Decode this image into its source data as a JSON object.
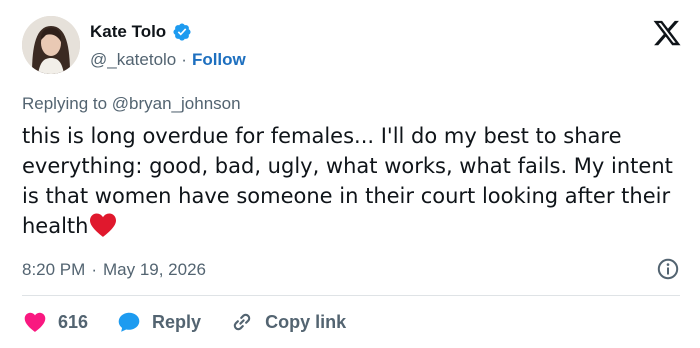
{
  "tweet": {
    "author": {
      "display_name": "Kate Tolo",
      "handle": "@_katetolo",
      "separator": "·",
      "follow_label": "Follow",
      "verified_icon": "verified-badge-icon"
    },
    "reply_to": "Replying to @bryan_johnson",
    "text": "this is long overdue for females... I'll do my best to share everything: good, bad, ugly, what works, what fails. My intent is that women have someone in their court looking after their health",
    "emoji": "red-heart-emoji",
    "time": "8:20 PM",
    "date_separator": "·",
    "date": "May 19, 2026",
    "likes": "616",
    "reply_label": "Reply",
    "copy_link_label": "Copy link"
  },
  "colors": {
    "text": "#0f1419",
    "secondary": "#536471",
    "link": "#1d6fbf",
    "like": "#f91880",
    "reply": "#1d9bf0",
    "verified": "#1d9bf0",
    "divider": "#dfe3e6"
  }
}
